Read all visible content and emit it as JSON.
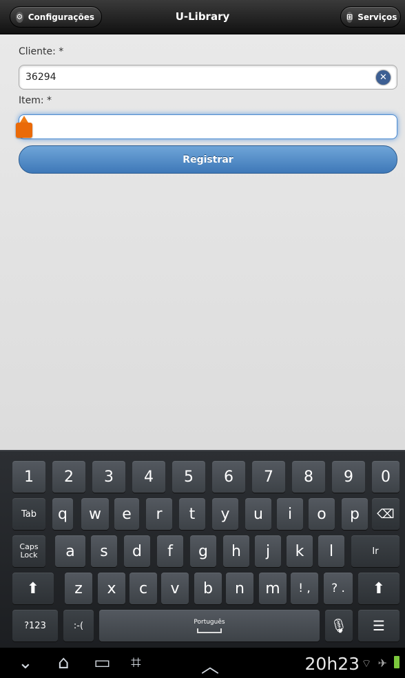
{
  "header": {
    "title": "U-Library",
    "left_button": "Configurações",
    "right_button": "Serviços",
    "left_icon": "gear-icon",
    "right_icon": "grid-icon"
  },
  "form": {
    "cliente_label": "Cliente: *",
    "cliente_value": "36294",
    "item_label": "Item: *",
    "item_value": "",
    "register_label": "Registrar"
  },
  "keyboard": {
    "row1": [
      "1",
      "2",
      "3",
      "4",
      "5",
      "6",
      "7",
      "8",
      "9",
      "0"
    ],
    "row2": [
      "q",
      "w",
      "e",
      "r",
      "t",
      "y",
      "u",
      "i",
      "o",
      "p"
    ],
    "row3": [
      "a",
      "s",
      "d",
      "f",
      "g",
      "h",
      "j",
      "k",
      "l"
    ],
    "row4": [
      "z",
      "x",
      "c",
      "v",
      "b",
      "n",
      "m"
    ],
    "tab": "Tab",
    "caps": "Caps\nLock",
    "ir": "Ir",
    "excl": "! ,",
    "quest": "? .",
    "sym": "?123",
    "emoji": ":-(",
    "space_label": "Português"
  },
  "statusbar": {
    "time": "20h23"
  },
  "colors": {
    "accent": "#3e78b8",
    "handle": "#ea6a08"
  }
}
